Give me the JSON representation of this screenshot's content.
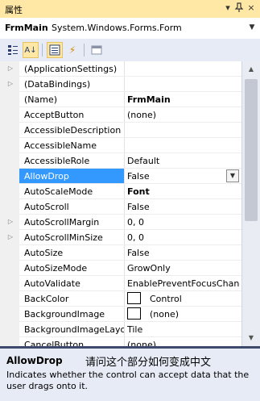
{
  "window": {
    "title": "属性"
  },
  "titlebar_buttons": {
    "menu": "▾",
    "pin": "ᵠ",
    "close": "×"
  },
  "object_selector": {
    "name": "FrmMain",
    "type": "System.Windows.Forms.Form",
    "dropdown": "▼"
  },
  "toolbar": {
    "icons": [
      "categorized-icon",
      "alphabetical-icon",
      "properties-icon",
      "events-icon",
      "property-pages-icon"
    ],
    "alphabetical_glyph": "A↓",
    "events_glyph": "⚡"
  },
  "grid": {
    "rows": [
      {
        "name": "(ApplicationSettings)",
        "value": "",
        "expandable": true
      },
      {
        "name": "(DataBindings)",
        "value": "",
        "expandable": true
      },
      {
        "name": "(Name)",
        "value": "FrmMain",
        "bold": true
      },
      {
        "name": "AcceptButton",
        "value": "(none)"
      },
      {
        "name": "AccessibleDescription",
        "value": ""
      },
      {
        "name": "AccessibleName",
        "value": ""
      },
      {
        "name": "AccessibleRole",
        "value": "Default"
      },
      {
        "name": "AllowDrop",
        "value": "False",
        "selected": true
      },
      {
        "name": "AutoScaleMode",
        "value": "Font",
        "bold": true
      },
      {
        "name": "AutoScroll",
        "value": "False"
      },
      {
        "name": "AutoScrollMargin",
        "value": "0, 0",
        "expandable": true
      },
      {
        "name": "AutoScrollMinSize",
        "value": "0, 0",
        "expandable": true
      },
      {
        "name": "AutoSize",
        "value": "False"
      },
      {
        "name": "AutoSizeMode",
        "value": "GrowOnly"
      },
      {
        "name": "AutoValidate",
        "value": "EnablePreventFocusChang"
      },
      {
        "name": "BackColor",
        "value": "Control",
        "swatch": true
      },
      {
        "name": "BackgroundImage",
        "value": "(none)",
        "swatch": true
      },
      {
        "name": "BackgroundImageLayout",
        "value": "Tile"
      },
      {
        "name": "CancelButton",
        "value": "(none)"
      }
    ]
  },
  "description": {
    "title": "AllowDrop",
    "note": "请问这个部分如何变成中文",
    "text": "Indicates whether the control can accept data that the user drags onto it."
  }
}
